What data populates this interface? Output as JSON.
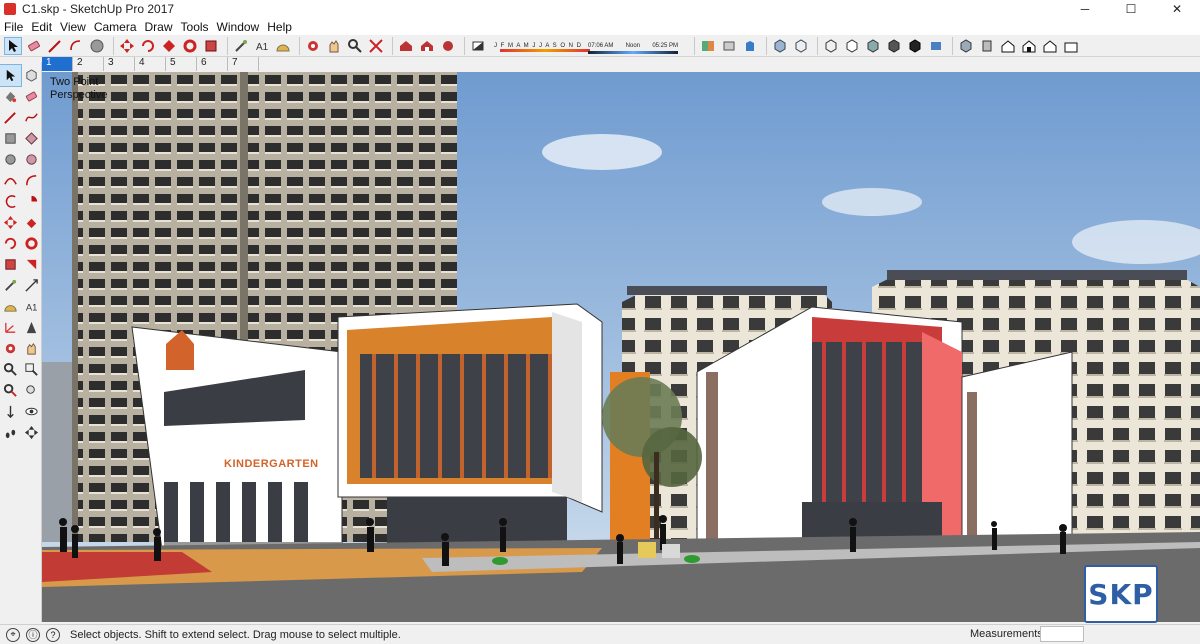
{
  "window": {
    "title": "C1.skp - SketchUp Pro 2017",
    "minimize": "─",
    "maximize": "☐",
    "close": "✕"
  },
  "menu": [
    "File",
    "Edit",
    "View",
    "Camera",
    "Draw",
    "Tools",
    "Window",
    "Help"
  ],
  "shadows": {
    "months": "J F M A M J J A S O N D",
    "time_start": "07:06 AM",
    "time_noon": "Noon",
    "time_end": "05:25 PM"
  },
  "scenes": [
    "1",
    "2",
    "3",
    "4",
    "5",
    "6",
    "7"
  ],
  "active_scene": "1",
  "viewport": {
    "camera_label_line1": "Two Point",
    "camera_label_line2": "Perspective",
    "building_sign": "KINDERGARTEN"
  },
  "watermark": "SKP",
  "status": {
    "message": "Select objects. Shift to extend select. Drag mouse to select multiple.",
    "measurements_label": "Measurements",
    "measurements_value": ""
  },
  "colors": {
    "accent_orange": "#d2632a",
    "accent_red": "#d6414a",
    "sky": "#8fb3d9",
    "selection_blue": "#1f6fd1"
  },
  "toolbar_icons": [
    "select-icon",
    "eraser-icon",
    "line-icon",
    "shape-icon",
    "paint-icon",
    "move-icon",
    "rotate-icon",
    "scale-icon",
    "follow-me-icon",
    "tape-icon",
    "protractor-icon",
    "text-icon",
    "orbit-icon",
    "pan-icon",
    "zoom-icon",
    "zoom-extents-icon",
    "warehouse-icon",
    "extension-icon",
    "share-icon",
    "shadow-toggle-icon",
    "section-icon",
    "display-section-icon",
    "style-xray-icon",
    "style-back-edges-icon",
    "style-wireframe-icon",
    "style-hidden-line-icon",
    "style-shaded-icon",
    "style-textures-icon",
    "style-monochrome-icon",
    "iso-view-icon",
    "top-view-icon",
    "front-view-icon",
    "right-view-icon",
    "back-view-icon",
    "left-view-icon"
  ],
  "left_tools": [
    "select-icon",
    "component-icon",
    "paint-bucket-icon",
    "eraser-icon",
    "line-icon",
    "freehand-icon",
    "rectangle-icon",
    "rotated-rectangle-icon",
    "circle-icon",
    "polygon-icon",
    "arc-icon",
    "two-point-arc-icon",
    "three-point-arc-icon",
    "pie-icon",
    "move-icon",
    "push-pull-icon",
    "rotate-icon",
    "follow-me-icon",
    "scale-icon",
    "offset-icon",
    "tape-measure-icon",
    "dimension-icon",
    "protractor-icon",
    "text-icon",
    "axes-icon",
    "3d-text-icon",
    "orbit-icon",
    "pan-icon",
    "zoom-icon",
    "zoom-window-icon",
    "zoom-extents-icon",
    "previous-view-icon",
    "position-camera-icon",
    "look-around-icon",
    "walk-icon",
    "section-plane-icon"
  ]
}
